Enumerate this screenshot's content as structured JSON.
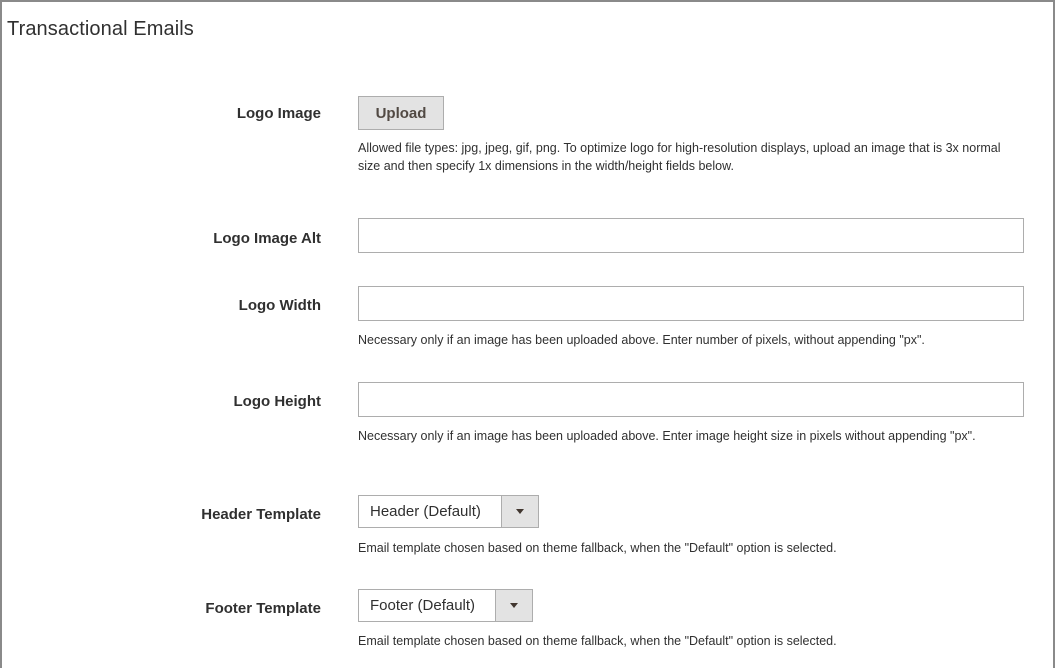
{
  "section": {
    "title": "Transactional Emails"
  },
  "logo_image": {
    "label": "Logo Image",
    "upload_label": "Upload",
    "note": "Allowed file types: jpg, jpeg, gif, png. To optimize logo for high-resolution displays, upload an image that is 3x normal size and then specify 1x dimensions in the width/height fields below."
  },
  "logo_image_alt": {
    "label": "Logo Image Alt",
    "value": ""
  },
  "logo_width": {
    "label": "Logo Width",
    "value": "",
    "note": "Necessary only if an image has been uploaded above. Enter number of pixels, without appending \"px\"."
  },
  "logo_height": {
    "label": "Logo Height",
    "value": "",
    "note": "Necessary only if an image has been uploaded above. Enter image height size in pixels without appending \"px\"."
  },
  "header_template": {
    "label": "Header Template",
    "selected": "Header (Default)",
    "note": "Email template chosen based on theme fallback, when the \"Default\" option is selected."
  },
  "footer_template": {
    "label": "Footer Template",
    "selected": "Footer (Default)",
    "note": "Email template chosen based on theme fallback, when the \"Default\" option is selected."
  },
  "icons": {
    "select_arrow": "chevron-down-icon"
  },
  "colors": {
    "button_bg": "#e3e3e3",
    "border": "#adadad",
    "text": "#303030"
  }
}
